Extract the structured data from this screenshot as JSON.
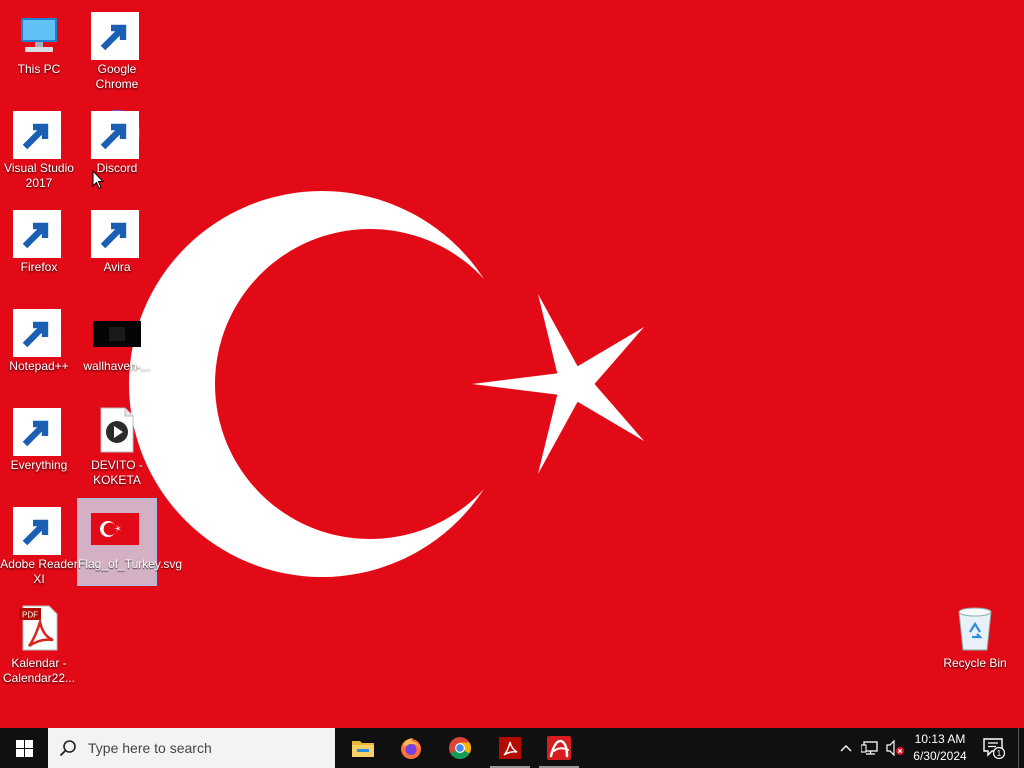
{
  "desktop": {
    "icons": [
      {
        "label": "This PC",
        "icon": "this-pc-icon"
      },
      {
        "label": "Google Chrome",
        "icon": "chrome-icon"
      },
      {
        "label": "Visual Studio 2017",
        "icon": "visual-studio-icon"
      },
      {
        "label": "Discord",
        "icon": "discord-icon"
      },
      {
        "label": "Firefox",
        "icon": "firefox-icon"
      },
      {
        "label": "Avira",
        "icon": "avira-icon"
      },
      {
        "label": "Notepad++",
        "icon": "notepad-plus-plus-icon"
      },
      {
        "label": "wallhaven-...",
        "icon": "image-thumbnail-icon"
      },
      {
        "label": "Everything",
        "icon": "everything-search-icon"
      },
      {
        "label": "DEVITO - KOKETA",
        "icon": "media-file-icon"
      },
      {
        "label": "Adobe Reader XI",
        "icon": "adobe-reader-icon"
      },
      {
        "label": "Flag_of_Turkey.svg",
        "icon": "svg-file-icon",
        "selected": true
      },
      {
        "label": "Kalendar - Calendar22...",
        "icon": "pdf-file-icon"
      },
      {
        "label": "Recycle Bin",
        "icon": "recycle-bin-icon"
      }
    ],
    "wallpaper": {
      "name": "Flag of Turkey",
      "red": "#E30A17",
      "white": "#FFFFFF"
    }
  },
  "taskbar": {
    "search_placeholder": "Type here to search",
    "pinned": [
      "file-explorer-icon",
      "firefox-icon",
      "chrome-icon",
      "adobe-reader-icon",
      "avira-icon"
    ],
    "clock": {
      "time": "10:13 AM",
      "date": "6/30/2024"
    },
    "notification_count": "1"
  }
}
